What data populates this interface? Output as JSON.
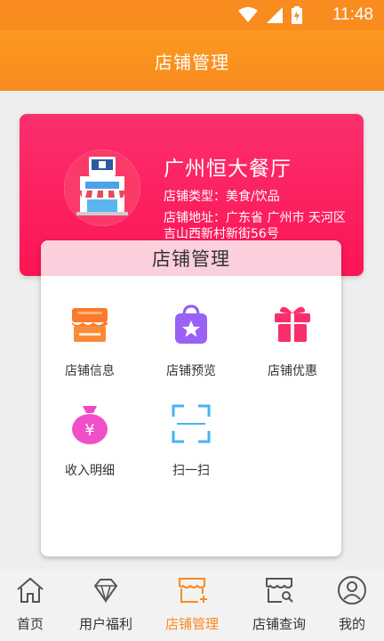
{
  "status_bar": {
    "time": "11:48"
  },
  "header": {
    "title": "店铺管理"
  },
  "shop": {
    "name": "广州恒大餐厅",
    "type": "店铺类型：美食/饮品",
    "address": "店铺地址：广东省 广州市 天河区 吉山西新村新街56号"
  },
  "panel": {
    "title": "店铺管理",
    "items": [
      {
        "label": "店铺信息",
        "icon": "shop-info-icon",
        "color": "#fb7a2a"
      },
      {
        "label": "店铺预览",
        "icon": "shopping-bag-star-icon",
        "color": "#8e5cf1"
      },
      {
        "label": "店铺优惠",
        "icon": "gift-icon",
        "color": "#fb2e6c"
      },
      {
        "label": "收入明细",
        "icon": "money-bag-icon",
        "color": "#f247c2"
      },
      {
        "label": "扫一扫",
        "icon": "scan-icon",
        "color": "#46b3f2"
      }
    ]
  },
  "tabs": [
    {
      "label": "首页",
      "icon": "home-icon"
    },
    {
      "label": "用户福利",
      "icon": "diamond-icon"
    },
    {
      "label": "店铺管理",
      "icon": "store-add-icon",
      "active": true
    },
    {
      "label": "店铺查询",
      "icon": "store-search-icon"
    },
    {
      "label": "我的",
      "icon": "user-icon"
    }
  ],
  "colors": {
    "accent": "#f98a1f",
    "card": "#fd1454"
  }
}
